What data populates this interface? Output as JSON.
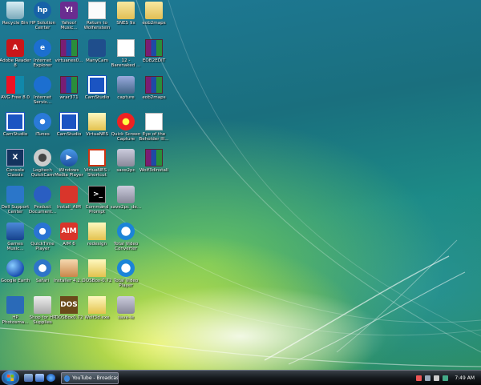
{
  "desktop": {
    "icons": [
      {
        "label": "Recycle Bin",
        "icon": "recycle-bin-icon",
        "style": "i-recycle",
        "glyph": ""
      },
      {
        "label": "HP Solution Center",
        "icon": "hp-icon",
        "style": "i-hp",
        "glyph": "hp"
      },
      {
        "label": "Yahoo! Music...",
        "icon": "yahoo-music-icon",
        "style": "i-yahoo",
        "glyph": "Y!"
      },
      {
        "label": "Return to Wolfenstein",
        "icon": "document-icon",
        "style": "i-doc",
        "glyph": ""
      },
      {
        "label": "SNES 9x",
        "icon": "folder-icon",
        "style": "i-folder",
        "glyph": ""
      },
      {
        "label": "eob2maps",
        "icon": "folder-icon",
        "style": "i-folder",
        "glyph": ""
      },
      {
        "label": "Adobe Reader 8",
        "icon": "adobe-reader-icon",
        "style": "i-adobe",
        "glyph": "A"
      },
      {
        "label": "Internet Explorer",
        "icon": "internet-explorer-icon",
        "style": "i-ie",
        "glyph": "e"
      },
      {
        "label": "virtuanes0...",
        "icon": "winrar-archive-icon",
        "style": "i-rar",
        "glyph": ""
      },
      {
        "label": "ManyCam",
        "icon": "manycam-icon",
        "style": "i-many",
        "glyph": ""
      },
      {
        "label": "12 - Barenaked ...",
        "icon": "mp3-file-icon",
        "style": "i-mp3",
        "glyph": "MP3"
      },
      {
        "label": "EOB2EDIT",
        "icon": "winrar-archive-icon",
        "style": "i-rar",
        "glyph": ""
      },
      {
        "label": "AVG Free 8.0",
        "icon": "avg-icon",
        "style": "i-avg",
        "glyph": ""
      },
      {
        "label": "Internet Servic...",
        "icon": "internet-services-icon",
        "style": "i-ie",
        "glyph": ""
      },
      {
        "label": "wrar371",
        "icon": "winrar-icon",
        "style": "i-rar",
        "glyph": ""
      },
      {
        "label": "CamStudio",
        "icon": "camstudio-icon",
        "style": "i-cam",
        "glyph": ""
      },
      {
        "label": "capture",
        "icon": "capture-icon",
        "style": "i-capture",
        "glyph": ""
      },
      {
        "label": "eob2maps",
        "icon": "winrar-archive-icon",
        "style": "i-rar",
        "glyph": ""
      },
      {
        "label": "CamStudio",
        "icon": "camstudio-icon",
        "style": "i-cam",
        "glyph": ""
      },
      {
        "label": "iTunes",
        "icon": "itunes-icon",
        "style": "i-itunes",
        "glyph": ""
      },
      {
        "label": "CamStudio",
        "icon": "camstudio-icon",
        "style": "i-cam",
        "glyph": ""
      },
      {
        "label": "VirtuaNES",
        "icon": "folder-icon",
        "style": "i-vnes",
        "glyph": ""
      },
      {
        "label": "Quick Screen Capture",
        "icon": "screen-capture-icon",
        "style": "i-screen",
        "glyph": ""
      },
      {
        "label": "Eye of the Beholder III...",
        "icon": "mp3-file-icon",
        "style": "i-mp3",
        "glyph": ""
      },
      {
        "label": "Console Classix",
        "icon": "console-classix-icon",
        "style": "i-console",
        "glyph": "X"
      },
      {
        "label": "Logitech QuickCam",
        "icon": "webcam-icon",
        "style": "i-logi",
        "glyph": ""
      },
      {
        "label": "Windows Media Player",
        "icon": "media-player-icon",
        "style": "i-wmp",
        "glyph": "▶"
      },
      {
        "label": "VirtuaNES - Shortcut",
        "icon": "shortcut-icon",
        "style": "i-shortcut",
        "glyph": ""
      },
      {
        "label": "save2pc",
        "icon": "save2pc-icon",
        "style": "i-save",
        "glyph": ""
      },
      {
        "label": "Wolf3dinstall",
        "icon": "winrar-archive-icon",
        "style": "i-rar",
        "glyph": ""
      },
      {
        "label": "Dell Support Center",
        "icon": "dell-support-icon",
        "style": "i-dell",
        "glyph": ""
      },
      {
        "label": "Product Document...",
        "icon": "product-documents-icon",
        "style": "i-prod",
        "glyph": ""
      },
      {
        "label": "Install_AIM",
        "icon": "aim-installer-icon",
        "style": "i-aim",
        "glyph": ""
      },
      {
        "label": "Command Prompt",
        "icon": "command-prompt-icon",
        "style": "i-cmd",
        "glyph": ">_"
      },
      {
        "label": "save2pc_de...",
        "icon": "save2pc-icon",
        "style": "i-save",
        "glyph": ""
      },
      {
        "label": "",
        "icon": "",
        "style": "",
        "glyph": ""
      },
      {
        "label": "Games Music...",
        "icon": "games-icon",
        "style": "i-game",
        "glyph": ""
      },
      {
        "label": "QuickTime Player",
        "icon": "quicktime-icon",
        "style": "i-qt",
        "glyph": ""
      },
      {
        "label": "AIM 6",
        "icon": "aim-icon",
        "style": "i-aim",
        "glyph": "AIM"
      },
      {
        "label": "redesign",
        "icon": "folder-icon",
        "style": "i-vnes",
        "glyph": ""
      },
      {
        "label": "Total Video Converter",
        "icon": "video-converter-icon",
        "style": "i-conv",
        "glyph": "C"
      },
      {
        "label": "",
        "icon": "",
        "style": "",
        "glyph": ""
      },
      {
        "label": "Google Earth",
        "icon": "google-earth-icon",
        "style": "i-gearth",
        "glyph": ""
      },
      {
        "label": "Safari",
        "icon": "safari-icon",
        "style": "i-safari",
        "glyph": ""
      },
      {
        "label": "Installer 4.2...",
        "icon": "installer-icon",
        "style": "i-install",
        "glyph": ""
      },
      {
        "label": "DOSBox-0.72",
        "icon": "folder-icon",
        "style": "i-vnes",
        "glyph": ""
      },
      {
        "label": "Total Video Player",
        "icon": "video-player-icon",
        "style": "i-conv",
        "glyph": "▶"
      },
      {
        "label": "",
        "icon": "",
        "style": "",
        "glyph": ""
      },
      {
        "label": "HP Photosma...",
        "icon": "hp-photosmart-icon",
        "style": "i-hpphoto",
        "glyph": ""
      },
      {
        "label": "Shop for HP Supplies",
        "icon": "printer-icon",
        "style": "i-printer",
        "glyph": ""
      },
      {
        "label": "DOSBox0.72",
        "icon": "dosbox-icon",
        "style": "i-dosbox",
        "glyph": "DOS"
      },
      {
        "label": "Wolf3d.exe",
        "icon": "folder-icon",
        "style": "i-vnes",
        "glyph": ""
      },
      {
        "label": "save-ie",
        "icon": "save2pc-icon",
        "style": "i-save",
        "glyph": ""
      },
      {
        "label": "",
        "icon": "",
        "style": "",
        "glyph": ""
      }
    ]
  },
  "taskbar": {
    "task_button": "YouTube - Broadcas...",
    "clock": "7:49 AM"
  },
  "colors": {
    "taskbar": "#161a1e",
    "start_orb": "#1f5fa8"
  }
}
